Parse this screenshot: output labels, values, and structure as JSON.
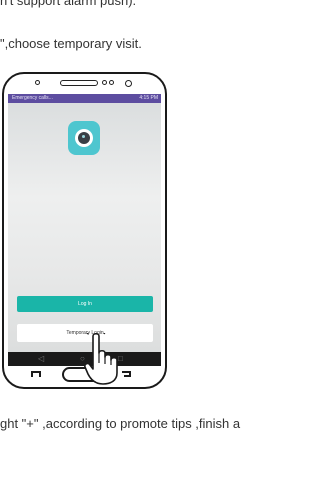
{
  "instructions": {
    "top_line": "n't support alarm push).",
    "choose_line": "\",choose temporary visit.",
    "bottom_line": "ght \"+\" ,according to promote tips ,finish a"
  },
  "phone_screen": {
    "status_left": "Emergency calls...",
    "status_right": "4:15 PM",
    "login_label": "Log In",
    "temporary_login_label": "Temporary Login"
  },
  "colors": {
    "status_bar": "#5d4da0",
    "app_icon": "#4ec6cf",
    "login_button": "#1ab5a8"
  },
  "icons": [
    "camera-app-icon",
    "back-icon",
    "home-icon",
    "recents-icon",
    "pointing-hand-icon"
  ]
}
